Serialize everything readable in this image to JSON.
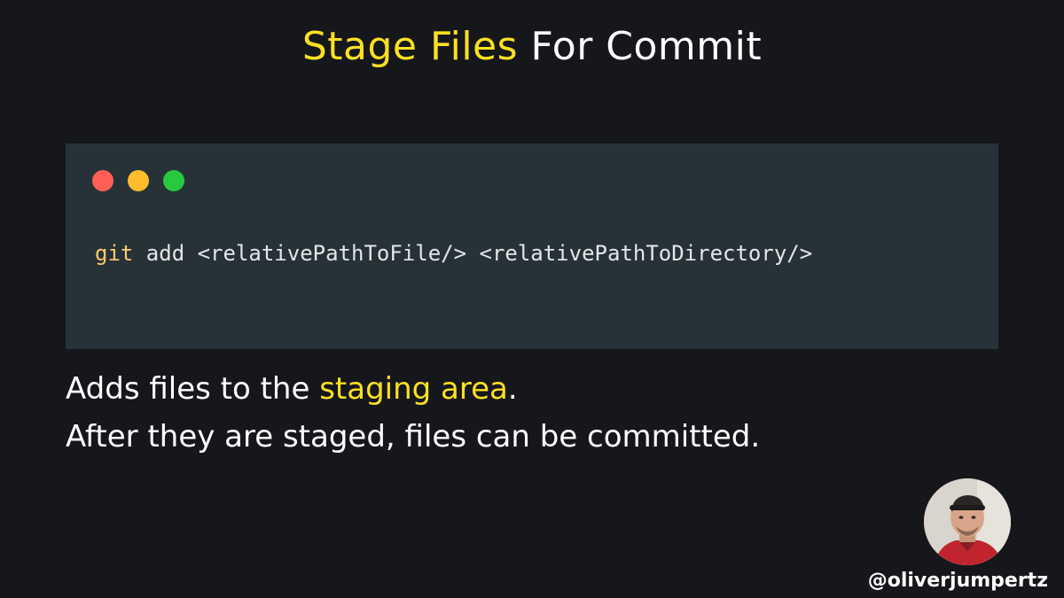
{
  "title": {
    "highlight": "Stage Files",
    "rest": " For Commit"
  },
  "code_window": {
    "command_keyword": "git",
    "command_rest": " add <relativePathToFile/> <relativePathToDirectory/>"
  },
  "description": {
    "line1_prefix": "Adds files to the ",
    "line1_highlight": "staging area",
    "line1_suffix": ".",
    "line2": "After they are staged, files can be committed."
  },
  "author": {
    "handle": "@oliverjumpertz",
    "avatar_icon": "author-avatar"
  },
  "colors": {
    "background": "#16171b",
    "accent": "#fce022",
    "code_bg": "#263238",
    "dot_red": "#ff5f56",
    "dot_yellow": "#ffbd2e",
    "dot_green": "#27c93f",
    "keyword": "#ffcb6b"
  }
}
